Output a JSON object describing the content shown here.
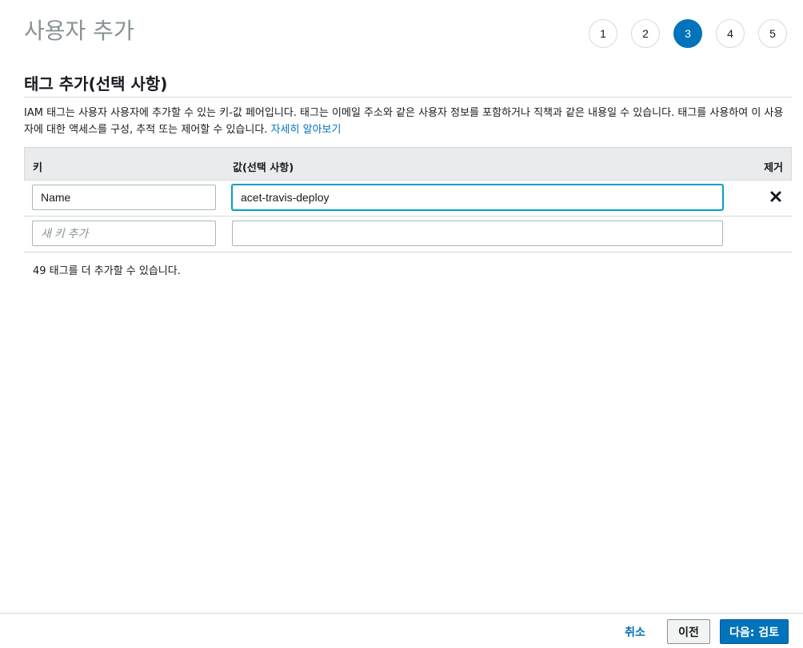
{
  "header": {
    "title": "사용자 추가",
    "steps": [
      "1",
      "2",
      "3",
      "4",
      "5"
    ],
    "active_step": "3"
  },
  "section": {
    "title": "태그 추가(선택 사항)",
    "description": "IAM 태그는 사용자 사용자에 추가할 수 있는 키-값 페어입니다. 태그는 이메일 주소와 같은 사용자 정보를 포함하거나 직책과 같은 내용일 수 있습니다. 태그를 사용하여 이 사용자에 대한 액세스를 구성, 추적 또는 제어할 수 있습니다.",
    "learn_more": "자세히 알아보기"
  },
  "table": {
    "col_key": "키",
    "col_value": "값(선택 사항)",
    "col_remove": "제거",
    "rows": [
      {
        "key": "Name",
        "value": "acet-travis-deploy"
      }
    ],
    "new_key_placeholder": "새 키 추가",
    "new_value_placeholder": ""
  },
  "remaining_text": "49 태그를 더 추가할 수 있습니다.",
  "footer": {
    "cancel": "취소",
    "previous": "이전",
    "next": "다음: 검토"
  },
  "colors": {
    "accent": "#0073bb",
    "focus": "#00a1c9"
  },
  "icons": {
    "remove": "close-icon"
  }
}
